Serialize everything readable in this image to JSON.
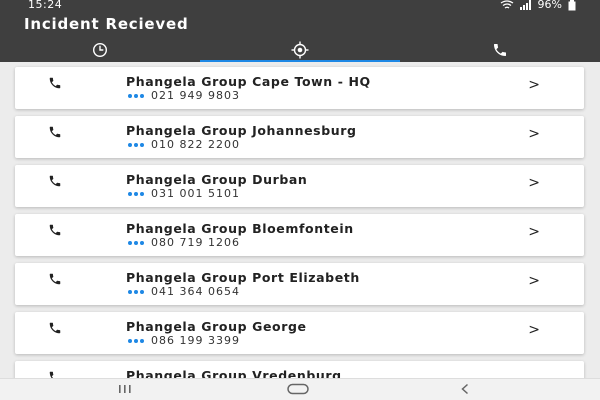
{
  "status_bar": {
    "time": "15:24",
    "battery": "96%",
    "icons": [
      "wifi-icon",
      "signal-icon",
      "battery-icon"
    ]
  },
  "header": {
    "title": "Incident Recieved",
    "tabs": [
      {
        "icon": "history-icon",
        "selected": false
      },
      {
        "icon": "gps-location-icon",
        "selected": true
      },
      {
        "icon": "phone-icon",
        "selected": false
      }
    ]
  },
  "contacts": [
    {
      "name": "Phangela Group Cape Town - HQ",
      "number": "021 949 9803"
    },
    {
      "name": "Phangela Group Johannesburg",
      "number": "010 822 2200"
    },
    {
      "name": "Phangela Group Durban",
      "number": "031 001 5101"
    },
    {
      "name": "Phangela Group Bloemfontein",
      "number": "080 719 1206"
    },
    {
      "name": "Phangela Group Port Elizabeth",
      "number": "041 364 0654"
    },
    {
      "name": "Phangela Group George",
      "number": "086 199 3399"
    },
    {
      "name": "Phangela Group Vredenburg",
      "number": ""
    }
  ],
  "chevron": ">",
  "nav_bar": {
    "icons": [
      "recent-apps-icon",
      "home-icon",
      "back-icon"
    ]
  },
  "colors": {
    "header_bg": "#3f3f3f",
    "accent": "#1e88e5",
    "list_bg": "#ececec"
  }
}
